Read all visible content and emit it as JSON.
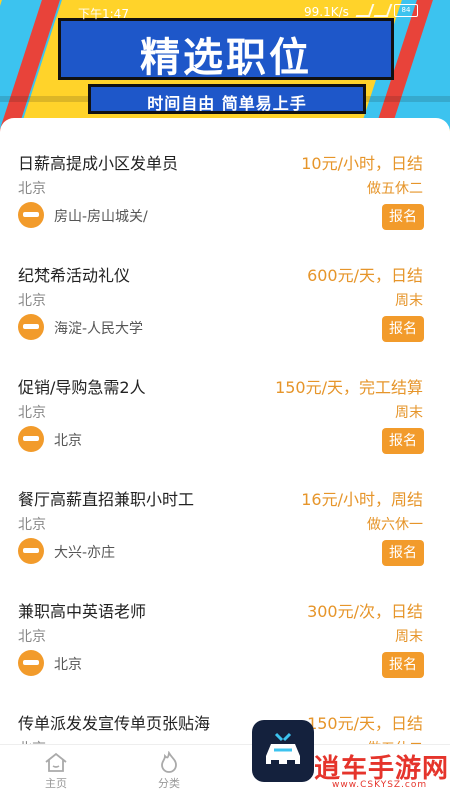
{
  "status_bar": {
    "time": "下午1:47",
    "speed": "99.1K/s",
    "battery": "84"
  },
  "banner": {
    "title": "精选职位",
    "subtitle": "时间自由 简单易上手"
  },
  "jobs": [
    {
      "title": "日薪高提成小区发单员",
      "pay": "10元/小时，日结",
      "city": "北京",
      "schedule": "做五休二",
      "location": "房山-房山城关/",
      "apply": "报名"
    },
    {
      "title": "纪梵希活动礼仪",
      "pay": "600元/天，日结",
      "city": "北京",
      "schedule": "周末",
      "location": "海淀-人民大学",
      "apply": "报名"
    },
    {
      "title": "促销/导购急需2人",
      "pay": "150元/天，完工结算",
      "city": "北京",
      "schedule": "周末",
      "location": "北京",
      "apply": "报名"
    },
    {
      "title": "餐厅高薪直招兼职小时工",
      "pay": "16元/小时，周结",
      "city": "北京",
      "schedule": "做六休一",
      "location": "大兴-亦庄",
      "apply": "报名"
    },
    {
      "title": "兼职高中英语老师",
      "pay": "300元/次，日结",
      "city": "北京",
      "schedule": "周末",
      "location": "北京",
      "apply": "报名"
    },
    {
      "title": "传单派发发宣传单页张贴海",
      "pay": "150元/天，日结",
      "city": "北京",
      "schedule": "做五休二",
      "location": "",
      "apply": ""
    }
  ],
  "tabbar": {
    "home": "主页",
    "category": "分类"
  },
  "watermark": {
    "text": "逍车手游网",
    "url": "www.CSKYSZ.com"
  },
  "colors": {
    "accent": "#f29b2b",
    "banner_blue": "#1e57c9",
    "banner_yellow": "#ffd32a"
  }
}
